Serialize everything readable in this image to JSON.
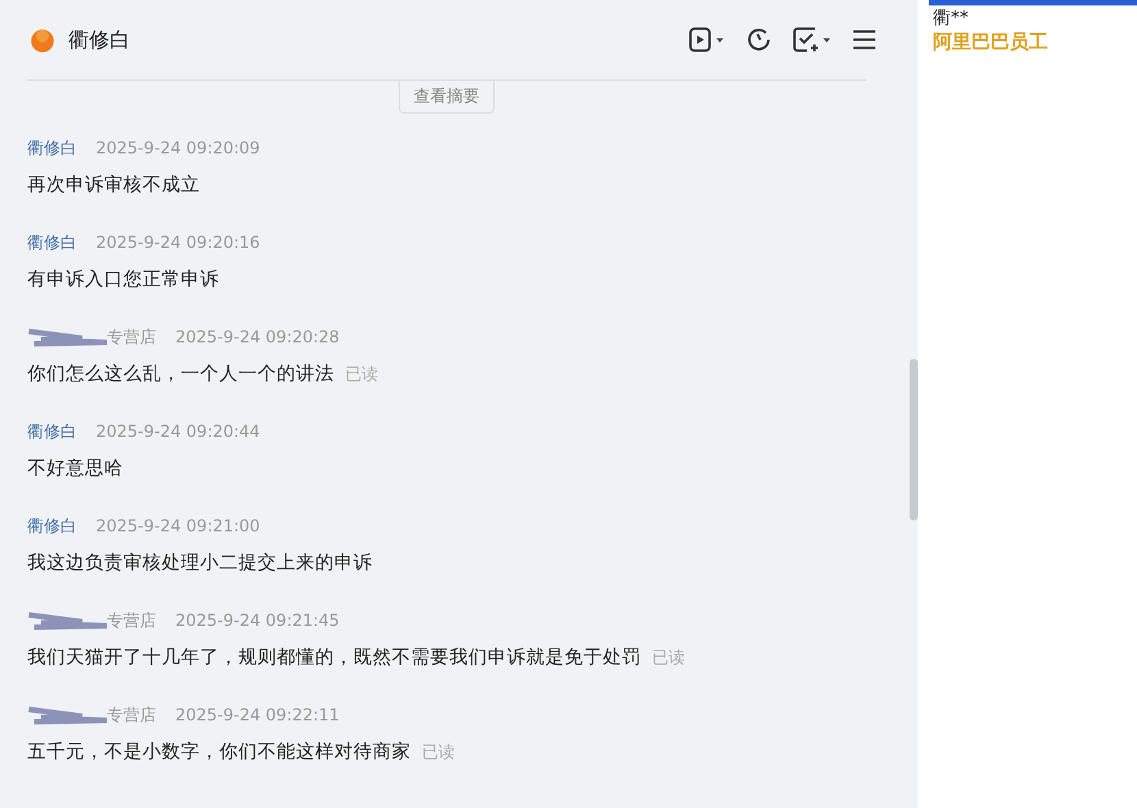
{
  "chat": {
    "title": "衢修白",
    "summary_button": "查看摘要",
    "messages": [
      {
        "kind": "staff",
        "sender": "衢修白",
        "time": "2025-9-24 09:20:09",
        "text": "再次申诉审核不成立"
      },
      {
        "kind": "staff",
        "sender": "衢修白",
        "time": "2025-9-24 09:20:16",
        "text": "有申诉入口您正常申诉"
      },
      {
        "kind": "shop",
        "sender": "专营店",
        "time": "2025-9-24 09:20:28",
        "text": "你们怎么这么乱，一个人一个的讲法",
        "receipt": "已读"
      },
      {
        "kind": "staff",
        "sender": "衢修白",
        "time": "2025-9-24 09:20:44",
        "text": "不好意思哈"
      },
      {
        "kind": "staff",
        "sender": "衢修白",
        "time": "2025-9-24 09:21:00",
        "text": "我这边负责审核处理小二提交上来的申诉"
      },
      {
        "kind": "shop",
        "sender": "专营店",
        "time": "2025-9-24 09:21:45",
        "text": "我们天猫开了十几年了，规则都懂的，既然不需要我们申诉就是免于处罚",
        "receipt": "已读"
      },
      {
        "kind": "shop",
        "sender": "专营店",
        "time": "2025-9-24 09:22:11",
        "text": "五千元，不是小数字，你们不能这样对待商家",
        "receipt": "已读"
      }
    ]
  },
  "profile": {
    "name": "衢**",
    "role": "阿里巴巴员工"
  }
}
